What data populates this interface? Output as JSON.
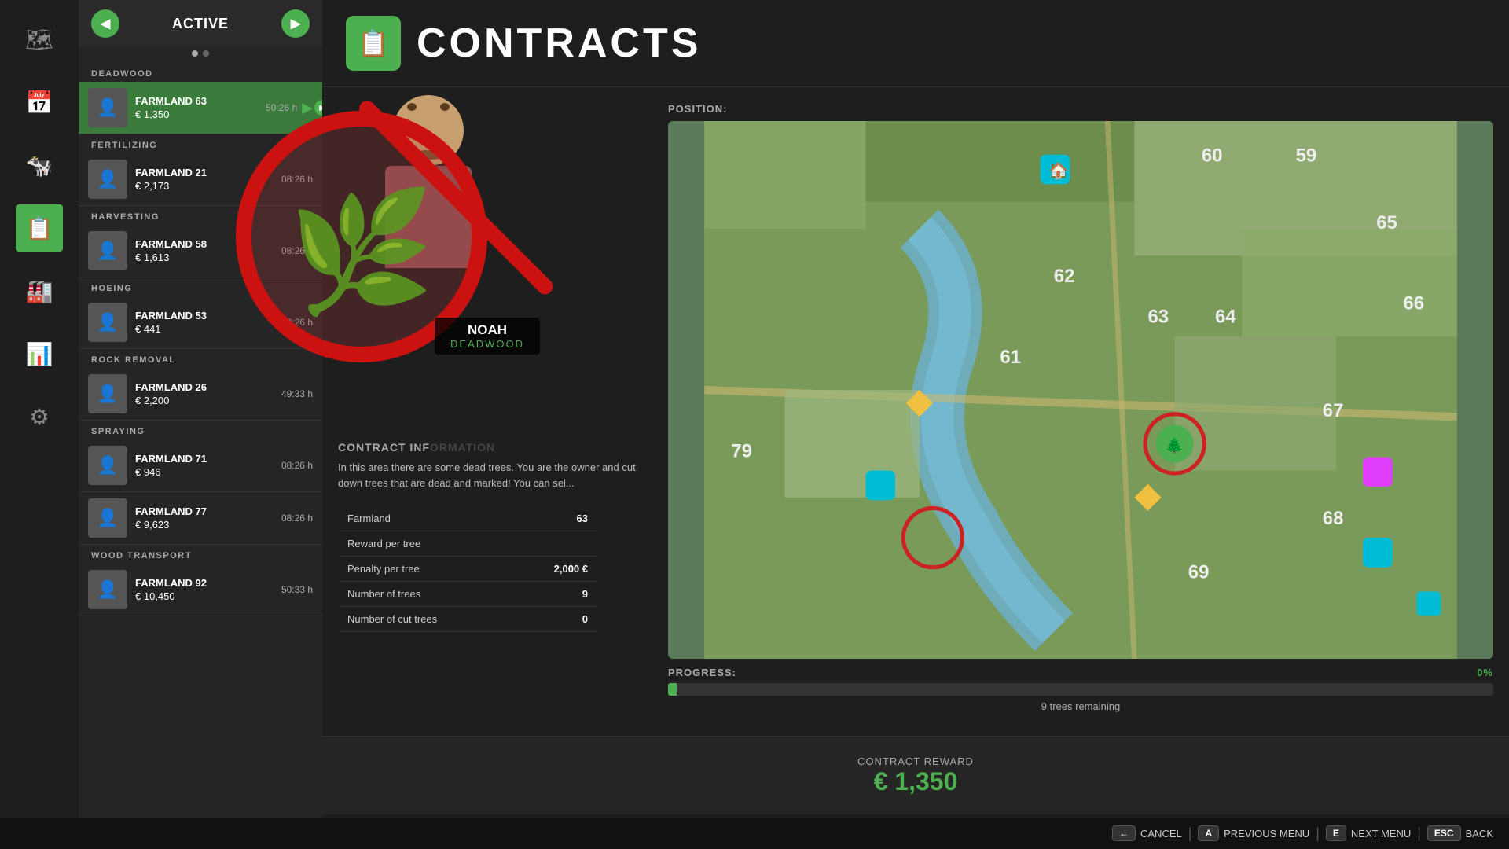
{
  "sidebar": {
    "icons": [
      {
        "name": "map-icon",
        "symbol": "🗺",
        "active": false
      },
      {
        "name": "calendar-icon",
        "symbol": "📅",
        "active": false
      },
      {
        "name": "cow-icon",
        "symbol": "🐄",
        "active": false
      },
      {
        "name": "contracts-icon",
        "symbol": "📋",
        "active": true
      },
      {
        "name": "factory-icon",
        "symbol": "🏭",
        "active": false
      },
      {
        "name": "stats-icon",
        "symbol": "📊",
        "active": false
      },
      {
        "name": "settings-icon",
        "symbol": "⚙",
        "active": false
      }
    ]
  },
  "panel": {
    "nav_left": "◀",
    "nav_right": "▶",
    "title": "ACTIVE",
    "sections": [
      {
        "label": "DEADWOOD",
        "items": [
          {
            "name": "FARMLAND 63",
            "reward": "€ 1,350",
            "time": "50:26 h",
            "selected": true
          }
        ]
      },
      {
        "label": "FERTILIZING",
        "items": [
          {
            "name": "FARMLAND 21",
            "reward": "€ 2,173",
            "time": "08:26 h",
            "selected": false
          }
        ]
      },
      {
        "label": "HARVESTING",
        "items": [
          {
            "name": "FARMLAND 58",
            "reward": "€ 1,613",
            "time": "08:26 h",
            "selected": false
          }
        ]
      },
      {
        "label": "HOEING",
        "items": [
          {
            "name": "FARMLAND 53",
            "reward": "€ 441",
            "time": "08:26 h",
            "selected": false
          }
        ]
      },
      {
        "label": "ROCK REMOVAL",
        "items": [
          {
            "name": "FARMLAND 26",
            "reward": "€ 2,200",
            "time": "49:33 h",
            "selected": false
          }
        ]
      },
      {
        "label": "SPRAYING",
        "items": [
          {
            "name": "FARMLAND 71",
            "reward": "€ 946",
            "time": "08:26 h",
            "selected": false
          },
          {
            "name": "FARMLAND 77",
            "reward": "€ 9,623",
            "time": "08:26 h",
            "selected": false
          }
        ]
      },
      {
        "label": "WOOD TRANSPORT",
        "items": [
          {
            "name": "FARMLAND 92",
            "reward": "€ 10,450",
            "time": "50:33 h",
            "selected": false
          }
        ]
      }
    ]
  },
  "contracts": {
    "header_icon": "📋",
    "title": "CONTRACTS"
  },
  "person": {
    "name": "NOAH",
    "subtitle": "DEADWOOD",
    "emoji": "👨‍🌾"
  },
  "cancel_symbol": "🚫",
  "cancel_inner_content": "🌿",
  "contract_info": {
    "header": "CONTRACT INFORMATION",
    "text": "In this area there are some dead trees. You are the owner and cut down trees that are dead and marked! You can sel..."
  },
  "detail_rows": [
    {
      "label": "Farmland",
      "value": "63"
    },
    {
      "label": "Reward per tree",
      "value": ""
    },
    {
      "label": "Penalty per tree",
      "value": "2,000 €"
    },
    {
      "label": "Number of trees",
      "value": "9"
    },
    {
      "label": "Number of cut trees",
      "value": "0"
    }
  ],
  "map": {
    "position_label": "POSITION:",
    "numbers": [
      "59",
      "60",
      "61",
      "62",
      "63",
      "64",
      "65",
      "66",
      "67",
      "68",
      "69",
      "79"
    ]
  },
  "progress": {
    "label": "PROGRESS:",
    "percent": "0%",
    "bar_width": "1",
    "remaining_text": "9 trees remaining"
  },
  "reward": {
    "label": "CONTRACT REWARD",
    "amount": "€ 1,350"
  },
  "bottom_bar": {
    "keys": [
      {
        "key": "←",
        "label": "CANCEL"
      },
      {
        "key": "A",
        "label": "PREVIOUS MENU"
      },
      {
        "key": "E",
        "label": "NEXT MENU"
      },
      {
        "key": "ESC",
        "label": "BACK"
      }
    ]
  }
}
